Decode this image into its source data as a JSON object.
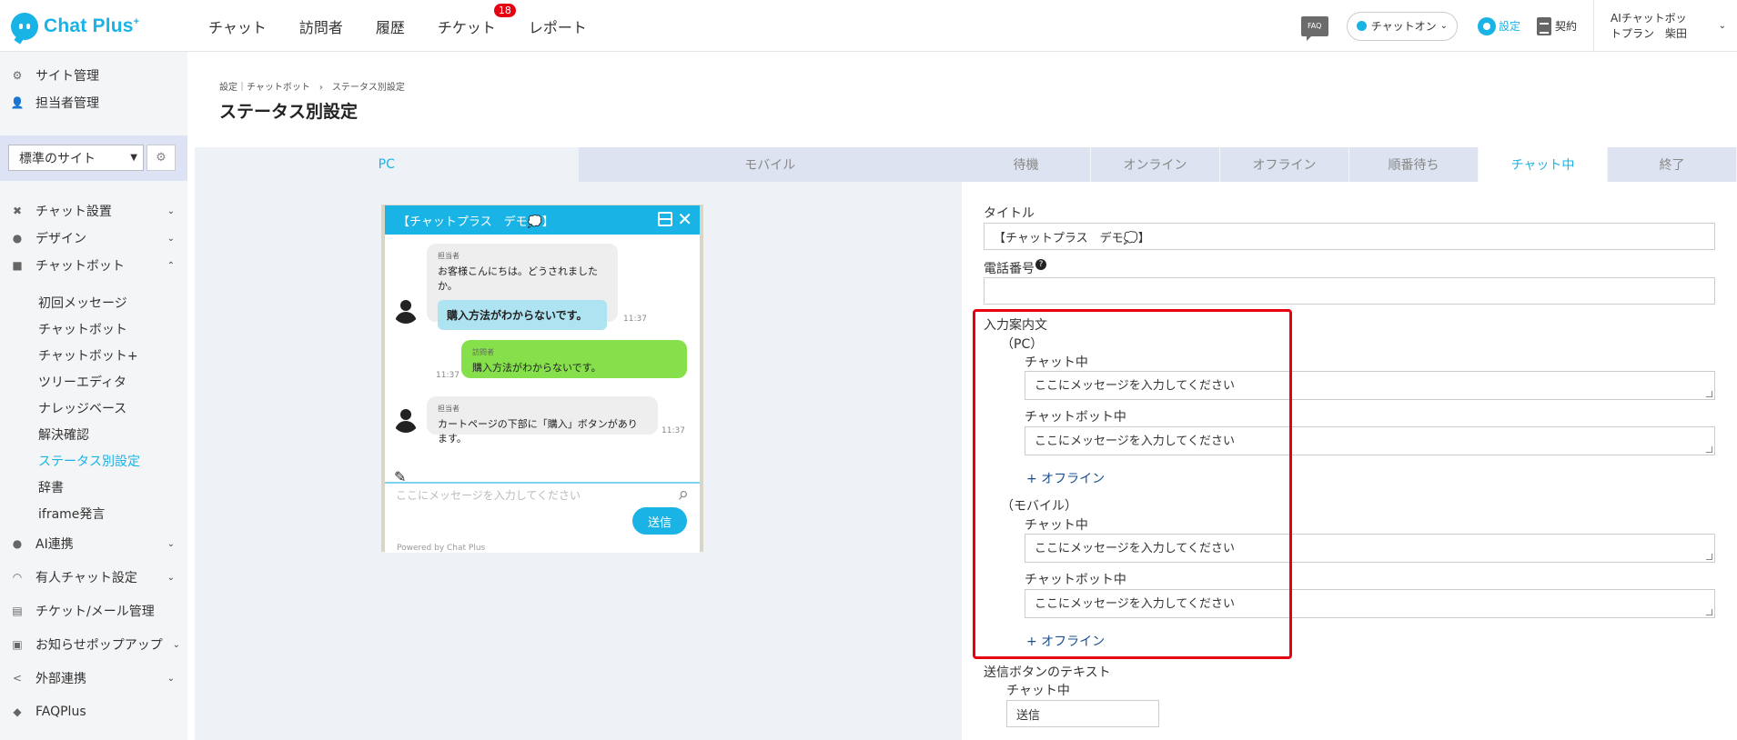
{
  "header": {
    "logo_text": "Chat Plus",
    "logo_plus": "+",
    "nav": [
      {
        "label": "チャット"
      },
      {
        "label": "訪問者"
      },
      {
        "label": "履歴"
      },
      {
        "label": "チケット",
        "badge": "18"
      },
      {
        "label": "レポート"
      }
    ],
    "faq_icon_label": "FAQ",
    "status_label": "チャットオン",
    "settings_label": "設定",
    "contract_label": "契約",
    "user_line1": "AIチャットボッ",
    "user_line2": "トプラン　柴田"
  },
  "sidebar": {
    "top_items": [
      {
        "label": "サイト管理",
        "icon": "gear-user-icon"
      },
      {
        "label": "担当者管理",
        "icon": "person-icon"
      }
    ],
    "site_select": "標準のサイト",
    "sections": [
      {
        "label": "チャット設置",
        "icon": "tools-icon"
      },
      {
        "label": "デザイン",
        "icon": "palette-icon"
      },
      {
        "label": "チャットボット",
        "icon": "chatbot-icon"
      }
    ],
    "chatbot_sub": [
      {
        "label": "初回メッセージ"
      },
      {
        "label": "チャットボット"
      },
      {
        "label": "チャットボット+"
      },
      {
        "label": "ツリーエディタ"
      },
      {
        "label": "ナレッジベース"
      },
      {
        "label": "解決確認"
      },
      {
        "label": "ステータス別設定",
        "active": true
      },
      {
        "label": "辞書"
      },
      {
        "label": "iframe発言"
      }
    ],
    "bottom_items": [
      {
        "label": "AI連携",
        "icon": "ai-icon"
      },
      {
        "label": "有人チャット設定",
        "icon": "headset-icon"
      },
      {
        "label": "チケット/メール管理",
        "icon": "list-icon"
      },
      {
        "label": "お知らせポップアップ",
        "icon": "popup-icon"
      },
      {
        "label": "外部連携",
        "icon": "share-icon"
      },
      {
        "label": "FAQPlus",
        "icon": "faqplus-icon"
      }
    ]
  },
  "main": {
    "breadcrumb": "設定｜チャットボット　›　ステータス別設定",
    "title": "ステータス別設定",
    "device_tabs": [
      {
        "label": "PC",
        "active": true
      },
      {
        "label": "モバイル",
        "active": false
      }
    ],
    "status_tabs": [
      {
        "label": "待機"
      },
      {
        "label": "オンライン"
      },
      {
        "label": "オフライン"
      },
      {
        "label": "順番待ち"
      },
      {
        "label": "チャット中",
        "active": true
      },
      {
        "label": "終了"
      }
    ]
  },
  "widget": {
    "title": "【チャットプラス　デモ💭】",
    "msg1_sender": "担当者",
    "msg1_text": "お客様こんにちは。どうされましたか。",
    "msg1_quick": "購入方法がわからないです。",
    "msg1_time": "11:37",
    "msg2_sender": "訪問者",
    "msg2_text": "購入方法がわからないです。",
    "msg2_time": "11:37",
    "msg3_sender": "担当者",
    "msg3_text": "カートページの下部に「購入」ボタンがあります。",
    "msg3_time": "11:37",
    "input_placeholder": "ここにメッセージを入力してください",
    "send_label": "送信",
    "powered": "Powered by Chat Plus"
  },
  "form": {
    "title_label": "タイトル",
    "title_value": "【チャットプラス　デモ💭】",
    "phone_label": "電話番号",
    "phone_value": "",
    "guide_label": "入力案内文",
    "pc_label": "（PC）",
    "mobile_label": "（モバイル）",
    "chatting_label": "チャット中",
    "chatbot_label": "チャットボット中",
    "placeholder_value": "ここにメッセージを入力してください",
    "offline_link": "+ オフライン",
    "send_text_label": "送信ボタンのテキスト",
    "send_chatting_label": "チャット中",
    "send_value": "送信"
  },
  "colors": {
    "accent": "#1ab3e6",
    "highlight": "#e60012",
    "visitor_bubble": "#86e04b"
  }
}
